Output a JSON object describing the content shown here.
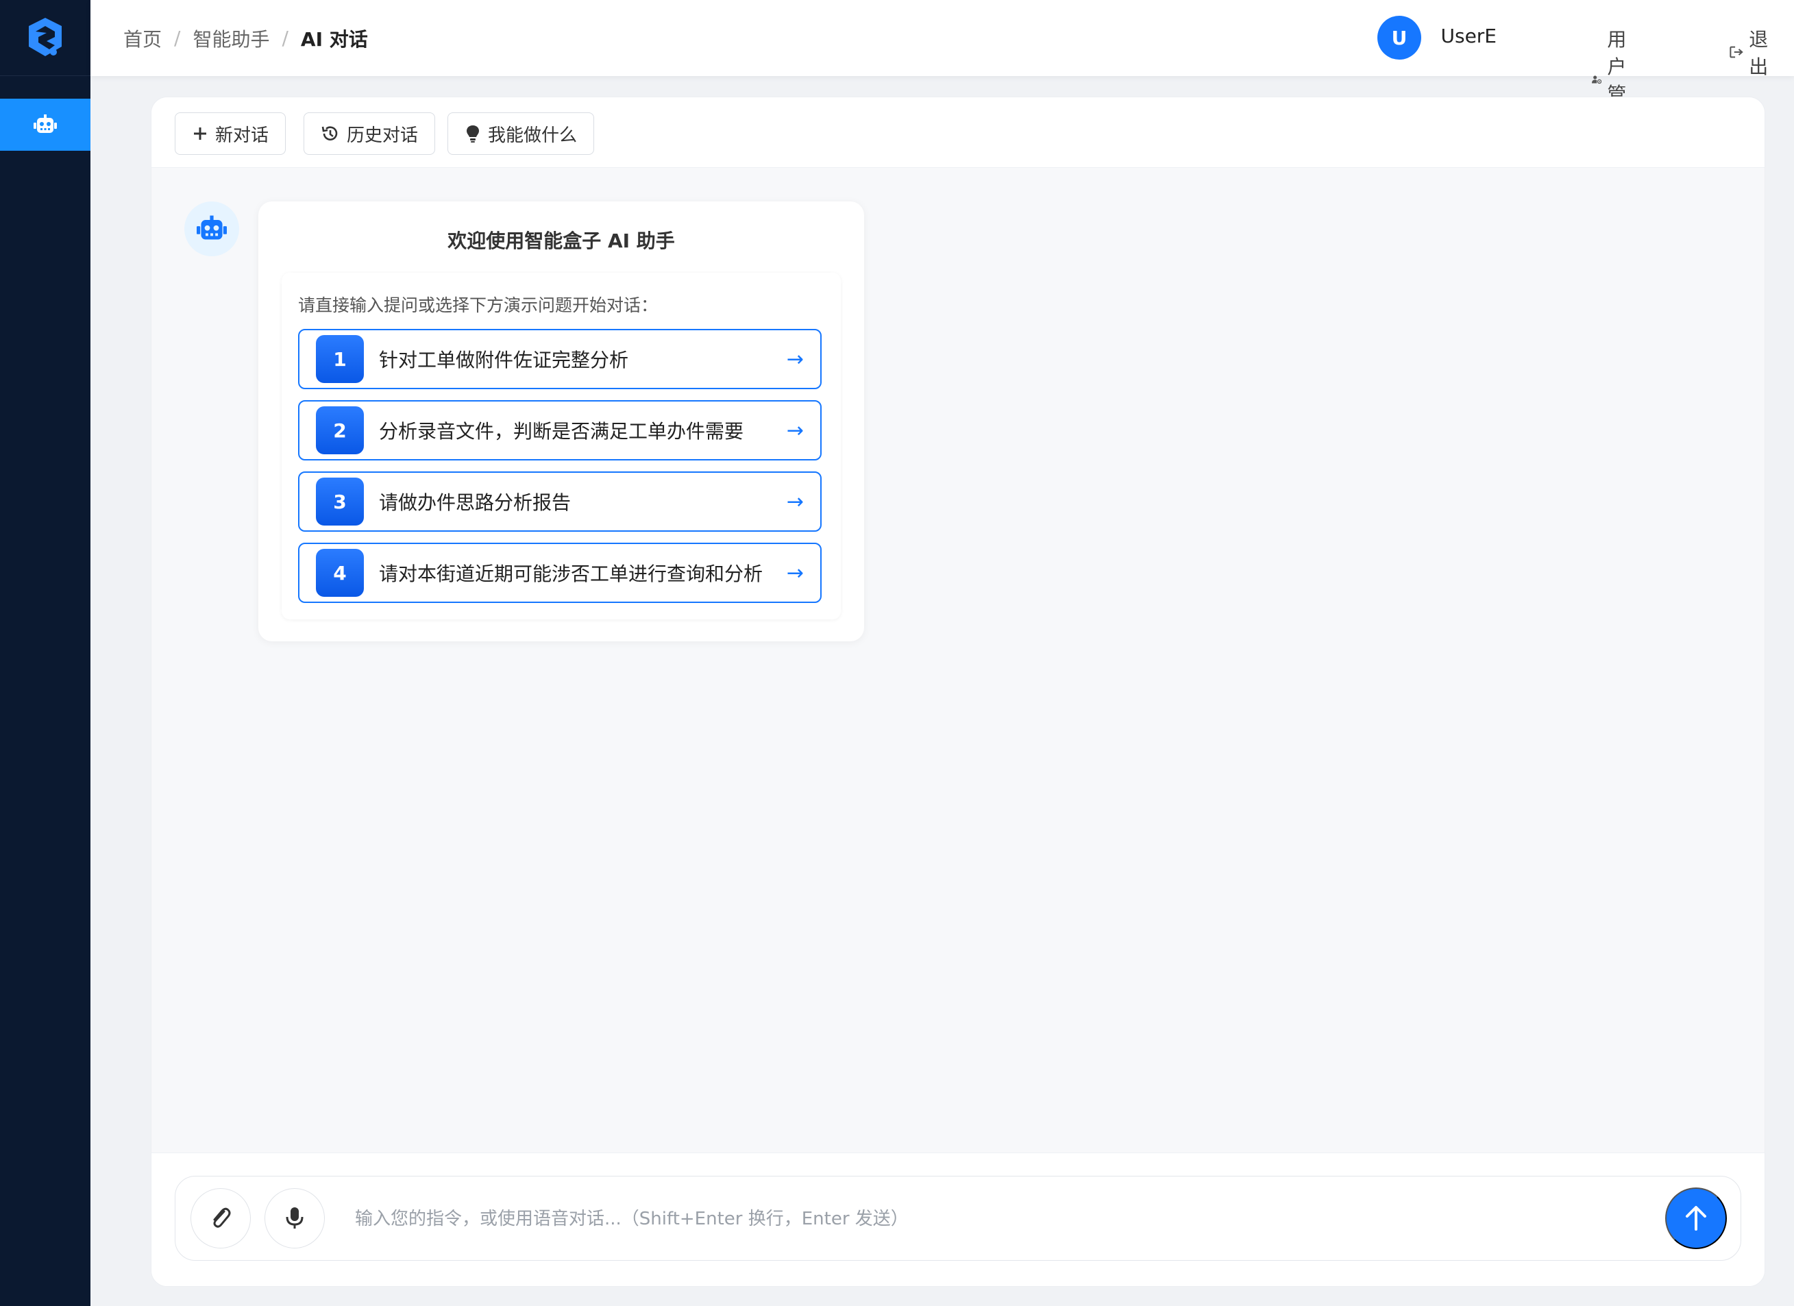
{
  "breadcrumb": {
    "home": "首页",
    "section": "智能助手",
    "current": "AI 对话",
    "separator": "/"
  },
  "user": {
    "avatar_initial": "U",
    "name": "UserE",
    "manage_label": "用户管理",
    "logout_label": "退出"
  },
  "toolbar": {
    "new_chat": "新对话",
    "history": "历史对话",
    "capabilities": "我能做什么"
  },
  "welcome": {
    "title": "欢迎使用智能盒子 AI 助手",
    "hint": "请直接输入提问或选择下方演示问题开始对话：",
    "suggestions": [
      {
        "num": "1",
        "text": "针对工单做附件佐证完整分析",
        "arrow": "→"
      },
      {
        "num": "2",
        "text": "分析录音文件，判断是否满足工单办件需要",
        "arrow": "→"
      },
      {
        "num": "3",
        "text": "请做办件思路分析报告",
        "arrow": "→"
      },
      {
        "num": "4",
        "text": "请对本街道近期可能涉否工单进行查询和分析",
        "arrow": "→"
      }
    ]
  },
  "input": {
    "placeholder": "输入您的指令，或使用语音对话...（Shift+Enter 换行，Enter 发送）",
    "value": ""
  },
  "icons": {
    "logo": "shield-logo-icon",
    "nav": "robot-icon",
    "attach": "paperclip-icon",
    "voice": "microphone-icon",
    "send": "arrow-up-icon"
  },
  "colors": {
    "primary": "#1677ff",
    "sidebar": "#0b1930",
    "nav_active": "#1890ff"
  }
}
